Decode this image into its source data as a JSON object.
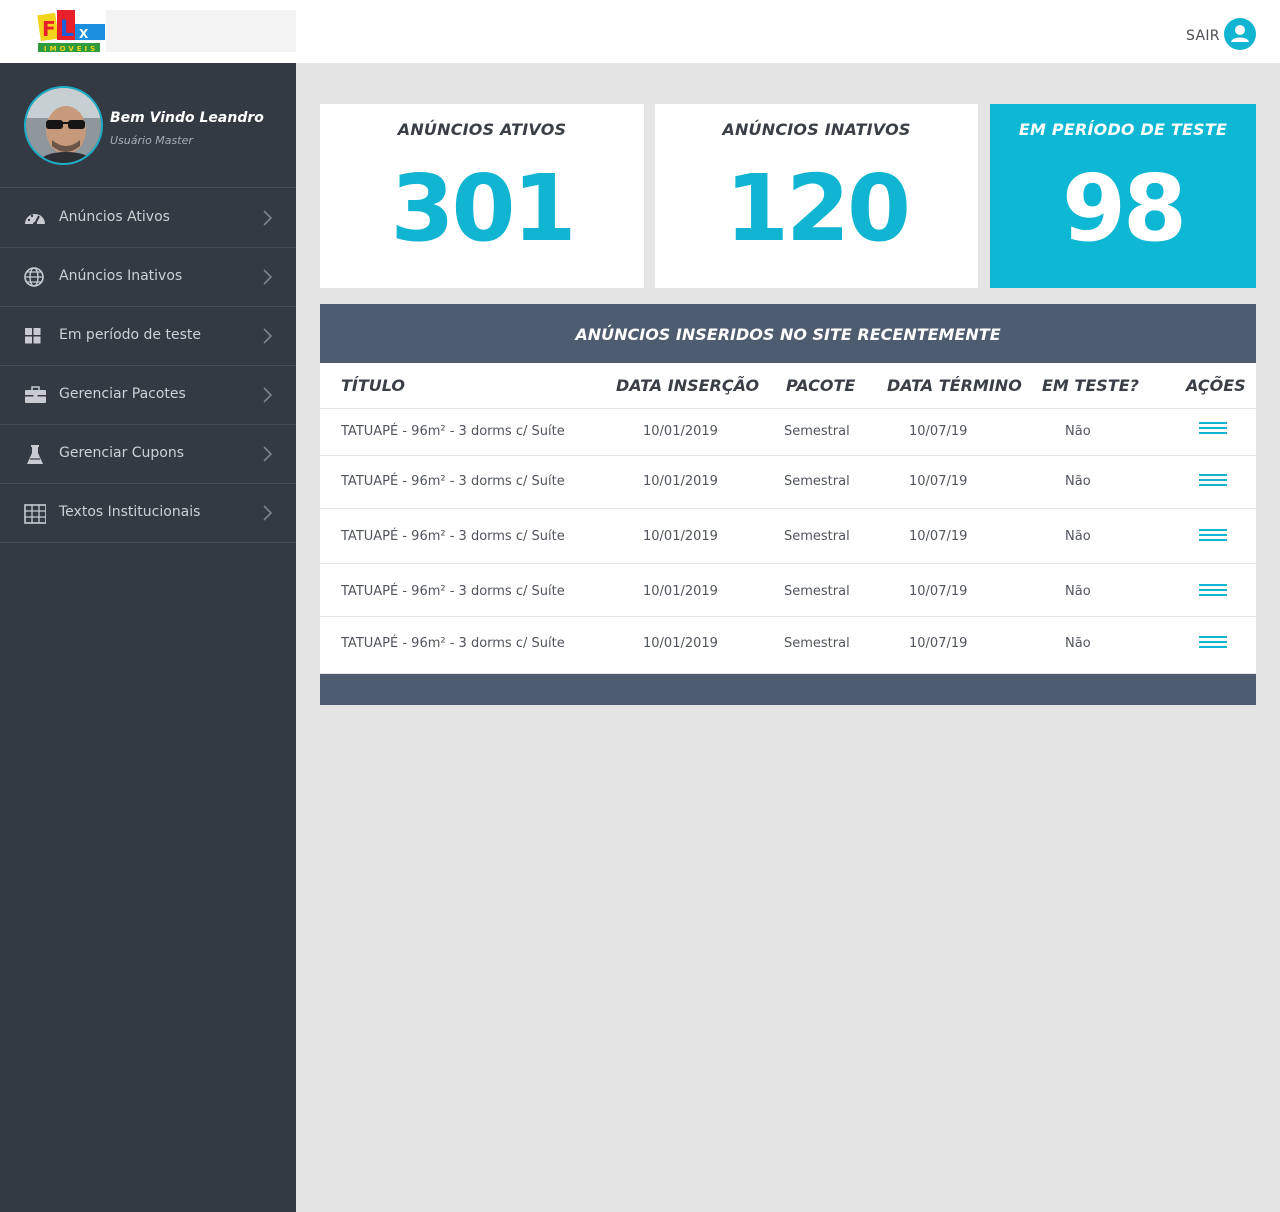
{
  "header": {
    "logo_text": "FLX IMÓVEIS",
    "logout_label": "SAIR"
  },
  "sidebar": {
    "welcome": "Bem Vindo Leandro",
    "role": "Usuário Master",
    "items": [
      {
        "label": "Anúncios Ativos",
        "icon": "dashboard-gauge-icon"
      },
      {
        "label": "Anúncios Inativos",
        "icon": "globe-icon"
      },
      {
        "label": "Em período de teste",
        "icon": "grid-tiles-icon"
      },
      {
        "label": "Gerenciar Pacotes",
        "icon": "briefcase-icon"
      },
      {
        "label": "Gerenciar Cupons",
        "icon": "flask-icon"
      },
      {
        "label": "Textos Institucionais",
        "icon": "table-grid-icon"
      }
    ]
  },
  "stats": [
    {
      "title": "ANÚNCIOS ATIVOS",
      "value": "301"
    },
    {
      "title": "ANÚNCIOS INATIVOS",
      "value": "120"
    },
    {
      "title": "EM PERÍODO DE TESTE",
      "value": "98"
    }
  ],
  "recent": {
    "title": "ANÚNCIOS INSERIDOS NO SITE RECENTEMENTE",
    "columns": [
      "TÍTULO",
      "DATA INSERÇÃO",
      "PACOTE",
      "DATA TÉRMINO",
      "EM TESTE?",
      "AÇÕES"
    ],
    "rows": [
      {
        "titulo": "TATUAPÉ - 96m² - 3 dorms c/ Suíte",
        "insercao": "10/01/2019",
        "pacote": "Semestral",
        "termino": "10/07/19",
        "teste": "Não"
      },
      {
        "titulo": "TATUAPÉ - 96m² - 3 dorms c/ Suíte",
        "insercao": "10/01/2019",
        "pacote": "Semestral",
        "termino": "10/07/19",
        "teste": "Não"
      },
      {
        "titulo": "TATUAPÉ - 96m² - 3 dorms c/ Suíte",
        "insercao": "10/01/2019",
        "pacote": "Semestral",
        "termino": "10/07/19",
        "teste": "Não"
      },
      {
        "titulo": "TATUAPÉ - 96m² - 3 dorms c/ Suíte",
        "insercao": "10/01/2019",
        "pacote": "Semestral",
        "termino": "10/07/19",
        "teste": "Não"
      },
      {
        "titulo": "TATUAPÉ - 96m² - 3 dorms c/ Suíte",
        "insercao": "10/01/2019",
        "pacote": "Semestral",
        "termino": "10/07/19",
        "teste": "Não"
      }
    ]
  },
  "colors": {
    "accent": "#11b5d1",
    "sidebar": "#343a44",
    "panel_header": "#4d5c6e",
    "background": "#e5e5e6"
  }
}
